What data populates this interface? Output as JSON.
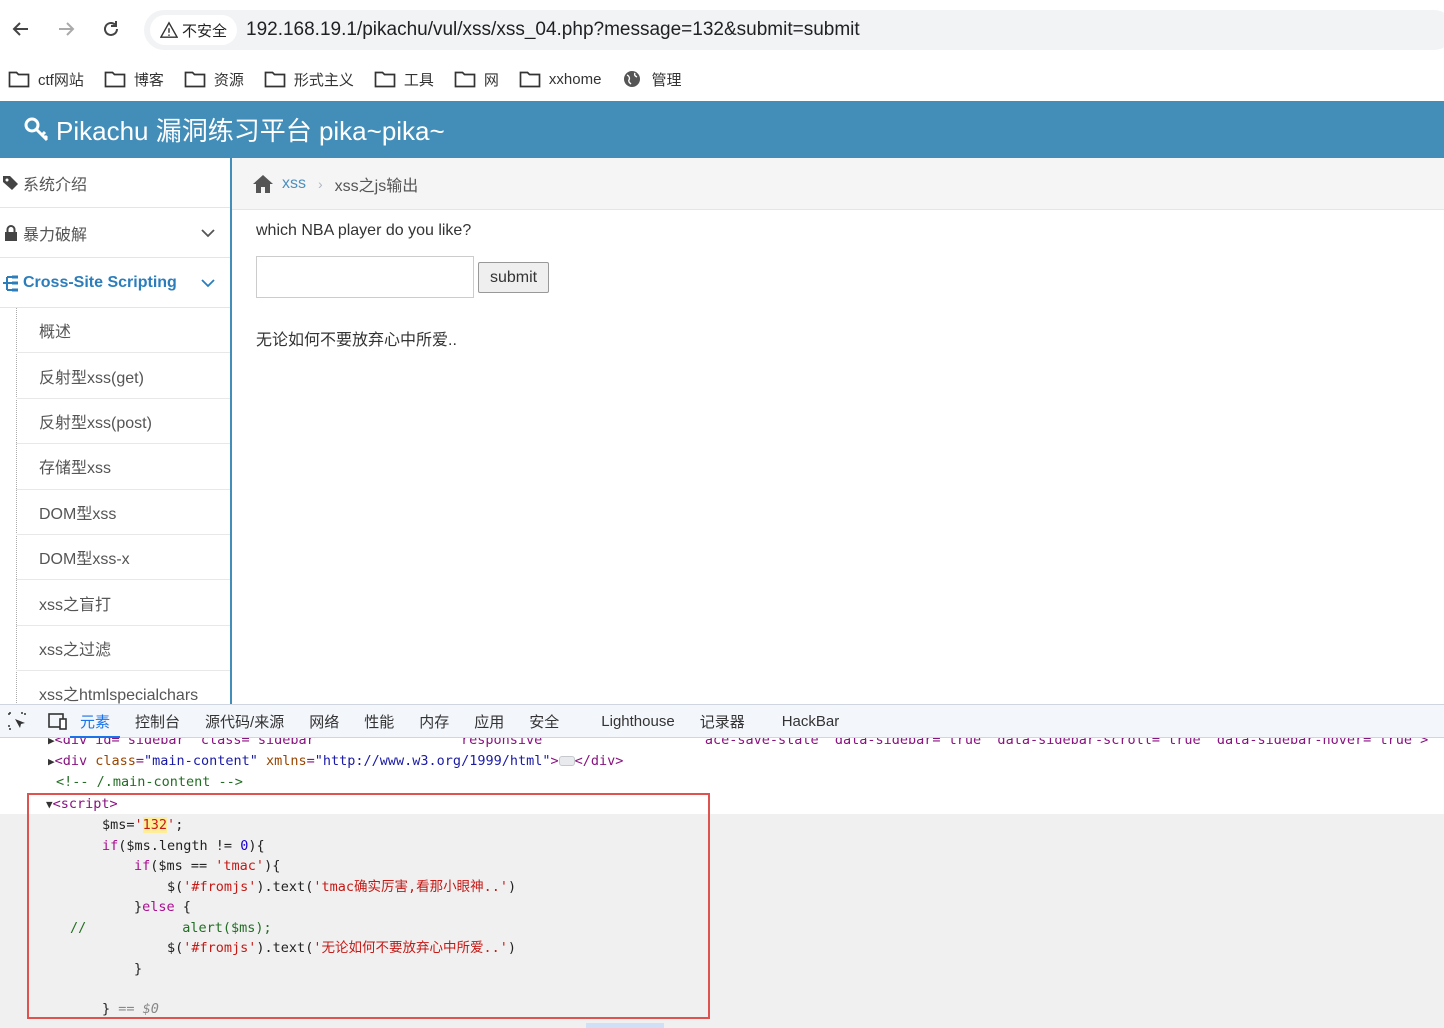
{
  "browser": {
    "security_label": "不安全",
    "url": "192.168.19.1/pikachu/vul/xss/xss_04.php?message=132&submit=submit"
  },
  "bookmarks": [
    {
      "label": "ctf网站",
      "icon": "folder-icon"
    },
    {
      "label": "博客",
      "icon": "folder-icon"
    },
    {
      "label": "资源",
      "icon": "folder-icon"
    },
    {
      "label": "形式主义",
      "icon": "folder-icon"
    },
    {
      "label": "工具",
      "icon": "folder-icon"
    },
    {
      "label": "网",
      "icon": "folder-icon"
    },
    {
      "label": "xxhome",
      "icon": "folder-icon"
    },
    {
      "label": "管理",
      "icon": "globe-icon"
    }
  ],
  "header": {
    "title": "Pikachu 漏洞练习平台 pika~pika~",
    "accent": "#438eb9"
  },
  "sidebar": {
    "items": [
      {
        "label": "系统介绍"
      },
      {
        "label": "暴力破解"
      },
      {
        "label": "Cross-Site Scripting"
      }
    ],
    "sub_items": [
      {
        "label": "概述"
      },
      {
        "label": "反射型xss(get)"
      },
      {
        "label": "反射型xss(post)"
      },
      {
        "label": "存储型xss"
      },
      {
        "label": "DOM型xss"
      },
      {
        "label": "DOM型xss-x"
      },
      {
        "label": "xss之盲打"
      },
      {
        "label": "xss之过滤"
      },
      {
        "label": "xss之htmlspecialchars"
      }
    ]
  },
  "breadcrumb": {
    "link": "xss",
    "current": "xss之js输出"
  },
  "main": {
    "question": "which NBA player do you like?",
    "input_value": "",
    "submit_label": "submit",
    "result": "无论如何不要放弃心中所爱.."
  },
  "devtools": {
    "tabs": [
      "元素",
      "控制台",
      "源代码/来源",
      "网络",
      "性能",
      "内存",
      "应用",
      "安全",
      "Lighthouse",
      "记录器",
      "HackBar"
    ],
    "selected_tab": "元素",
    "code": {
      "line0": "<div id=\"sidebar\" class=\"sidebar                  responsive                    ace-save-state\" data-sidebar=\"true\" data-sidebar-scroll=\"true\" data-sidebar-hover=\"true\">",
      "line1_tag": "<div ",
      "line1_attr1": "class",
      "line1_val1": "\"main-content\"",
      "line1_attr2": "xmlns",
      "line1_val2": "\"http://www.w3.org/1999/html\"",
      "line1_close": "</div>",
      "line2": "<!-- /.main-content -->",
      "line3": "<script>",
      "l4_a": "$ms=",
      "l4_str_open": "'",
      "l4_val": "132",
      "l4_str_close": "'",
      "l4_end": ";",
      "l5_kw": "if",
      "l5_a": "($ms.length != ",
      "l5_num": "0",
      "l5_b": "){",
      "l6_kw": "if",
      "l6_a": "($ms == ",
      "l6_str": "'tmac'",
      "l6_b": "){",
      "l7_a": "$(",
      "l7_str1": "'#fromjs'",
      "l7_b": ").text(",
      "l7_str2": "'tmac确实厉害,看那小眼神..'",
      "l7_c": ")",
      "l8_a": "}",
      "l8_kw": "else",
      "l8_b": " {",
      "l9_comment": "//",
      "l9_code": "alert($ms);",
      "l10_a": "$(",
      "l10_str1": "'#fromjs'",
      "l10_b": ").text(",
      "l10_str2": "'无论如何不要放弃心中所爱..'",
      "l10_c": ")",
      "l11": "}",
      "l12": "}",
      "l12_eq": " == $0"
    }
  }
}
